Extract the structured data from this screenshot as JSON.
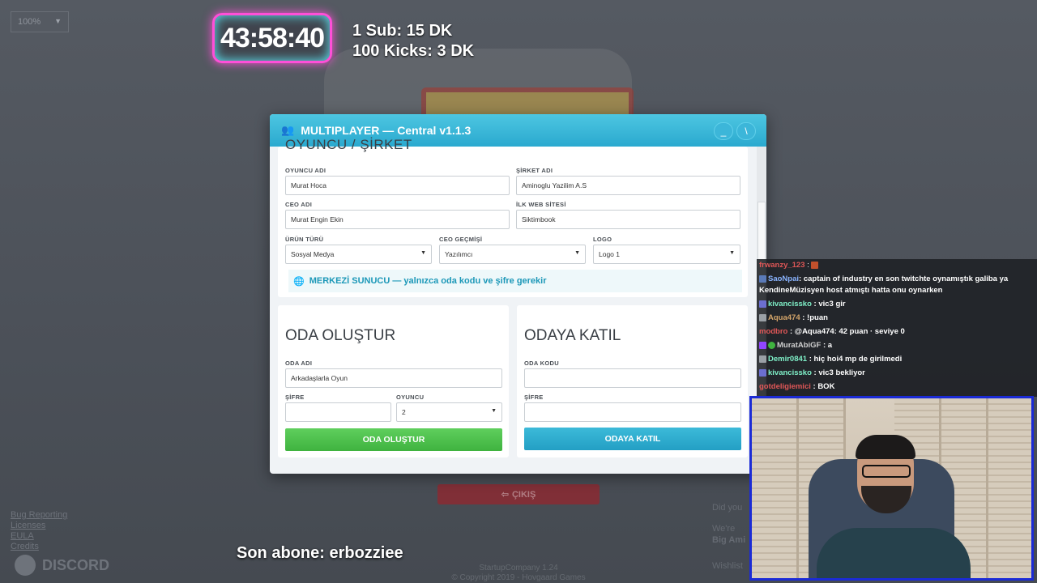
{
  "zoom": {
    "value": "100%"
  },
  "overlay": {
    "timer": "43:58:40",
    "rule1": "1 Sub: 15 DK",
    "rule2": "100 Kicks: 3 DK",
    "last_sub": "Son abone: erbozziee"
  },
  "background": {
    "links": [
      "Bug Reporting",
      "Licenses",
      "EULA",
      "Credits"
    ],
    "discord": "DISCORD",
    "exit_button": "ÇIKIŞ",
    "footer": [
      "StartupCompany 1.24",
      "© Copyright 2019 - Hovgaard Games"
    ],
    "right_text": [
      "Did you",
      "We're",
      "Big Ami",
      "Wishlist"
    ]
  },
  "window": {
    "title": "MULTIPLAYER — Central v1.1.3",
    "min_label": "_",
    "close_label": "\\",
    "section_title": "OYUNCU / ŞİRKET",
    "player_name_label": "OYUNCU ADI",
    "player_name_value": "Murat Hoca",
    "company_name_label": "ŞİRKET ADI",
    "company_name_value": "Aminoglu Yazilim A.S",
    "ceo_name_label": "CEO ADI",
    "ceo_name_value": "Murat Engin Ekin",
    "website_label": "İLK WEB SİTESİ",
    "website_value": "Siktimbook",
    "product_type_label": "ÜRÜN TÜRÜ",
    "product_type_value": "Sosyal Medya",
    "ceo_past_label": "CEO GEÇMİŞİ",
    "ceo_past_value": "Yazılımcı",
    "logo_label": "LOGO",
    "logo_value": "Logo 1",
    "info": "MERKEZİ SUNUCU — yalnızca oda kodu ve şifre gerekir",
    "create": {
      "title": "ODA OLUŞTUR",
      "room_name_label": "ODA ADI",
      "room_name_value": "Arkadaşlarla Oyun",
      "password_label": "ŞİFRE",
      "password_value": "",
      "player_label": "OYUNCU",
      "player_value": "2",
      "button": "ODA OLUŞTUR"
    },
    "join": {
      "title": "ODAYA KATIL",
      "room_code_label": "ODA KODU",
      "room_code_value": "",
      "password_label": "ŞİFRE",
      "password_value": "",
      "button": "ODAYA KATIL"
    }
  },
  "chat": {
    "messages": [
      {
        "user": "frwanzy_123",
        "text": "",
        "color": "#e05757"
      },
      {
        "user": "SaoNpai",
        "text": ": captain of industry en son twitchte oynamıştık galiba ya",
        "color": "#8ab4ff"
      },
      {
        "user": "",
        "text": "KendineMüzisyen host atmıştı hatta onu oynarken",
        "color": "#ffffff"
      },
      {
        "user": "kivancissko",
        "text": ": vic3 gir",
        "color": "#7ff0c8"
      },
      {
        "user": "Aqua474",
        "text": ": !puan",
        "color": "#d4a56a"
      },
      {
        "user": "modbro",
        "text": ": @Aqua474: 42 puan · seviye 0",
        "color": "#e05757"
      },
      {
        "user": "MuratAbiGF",
        "text": ": a",
        "color": "#d0d0d0"
      },
      {
        "user": "Demir0841",
        "text": ": hiç hoi4 mp de girilmedi",
        "color": "#7ff0c8"
      },
      {
        "user": "kivancissko",
        "text": ": vic3 bekliyor",
        "color": "#7ff0c8"
      },
      {
        "user": "gotdeligiemici",
        "text": ": BOK",
        "color": "#e05757"
      }
    ]
  },
  "colors": {
    "accent": "#2aa9cf",
    "create_button": "#3fb33f",
    "webcam_border": "#1b2bd6",
    "timer_glow": "#ff4fd8"
  }
}
